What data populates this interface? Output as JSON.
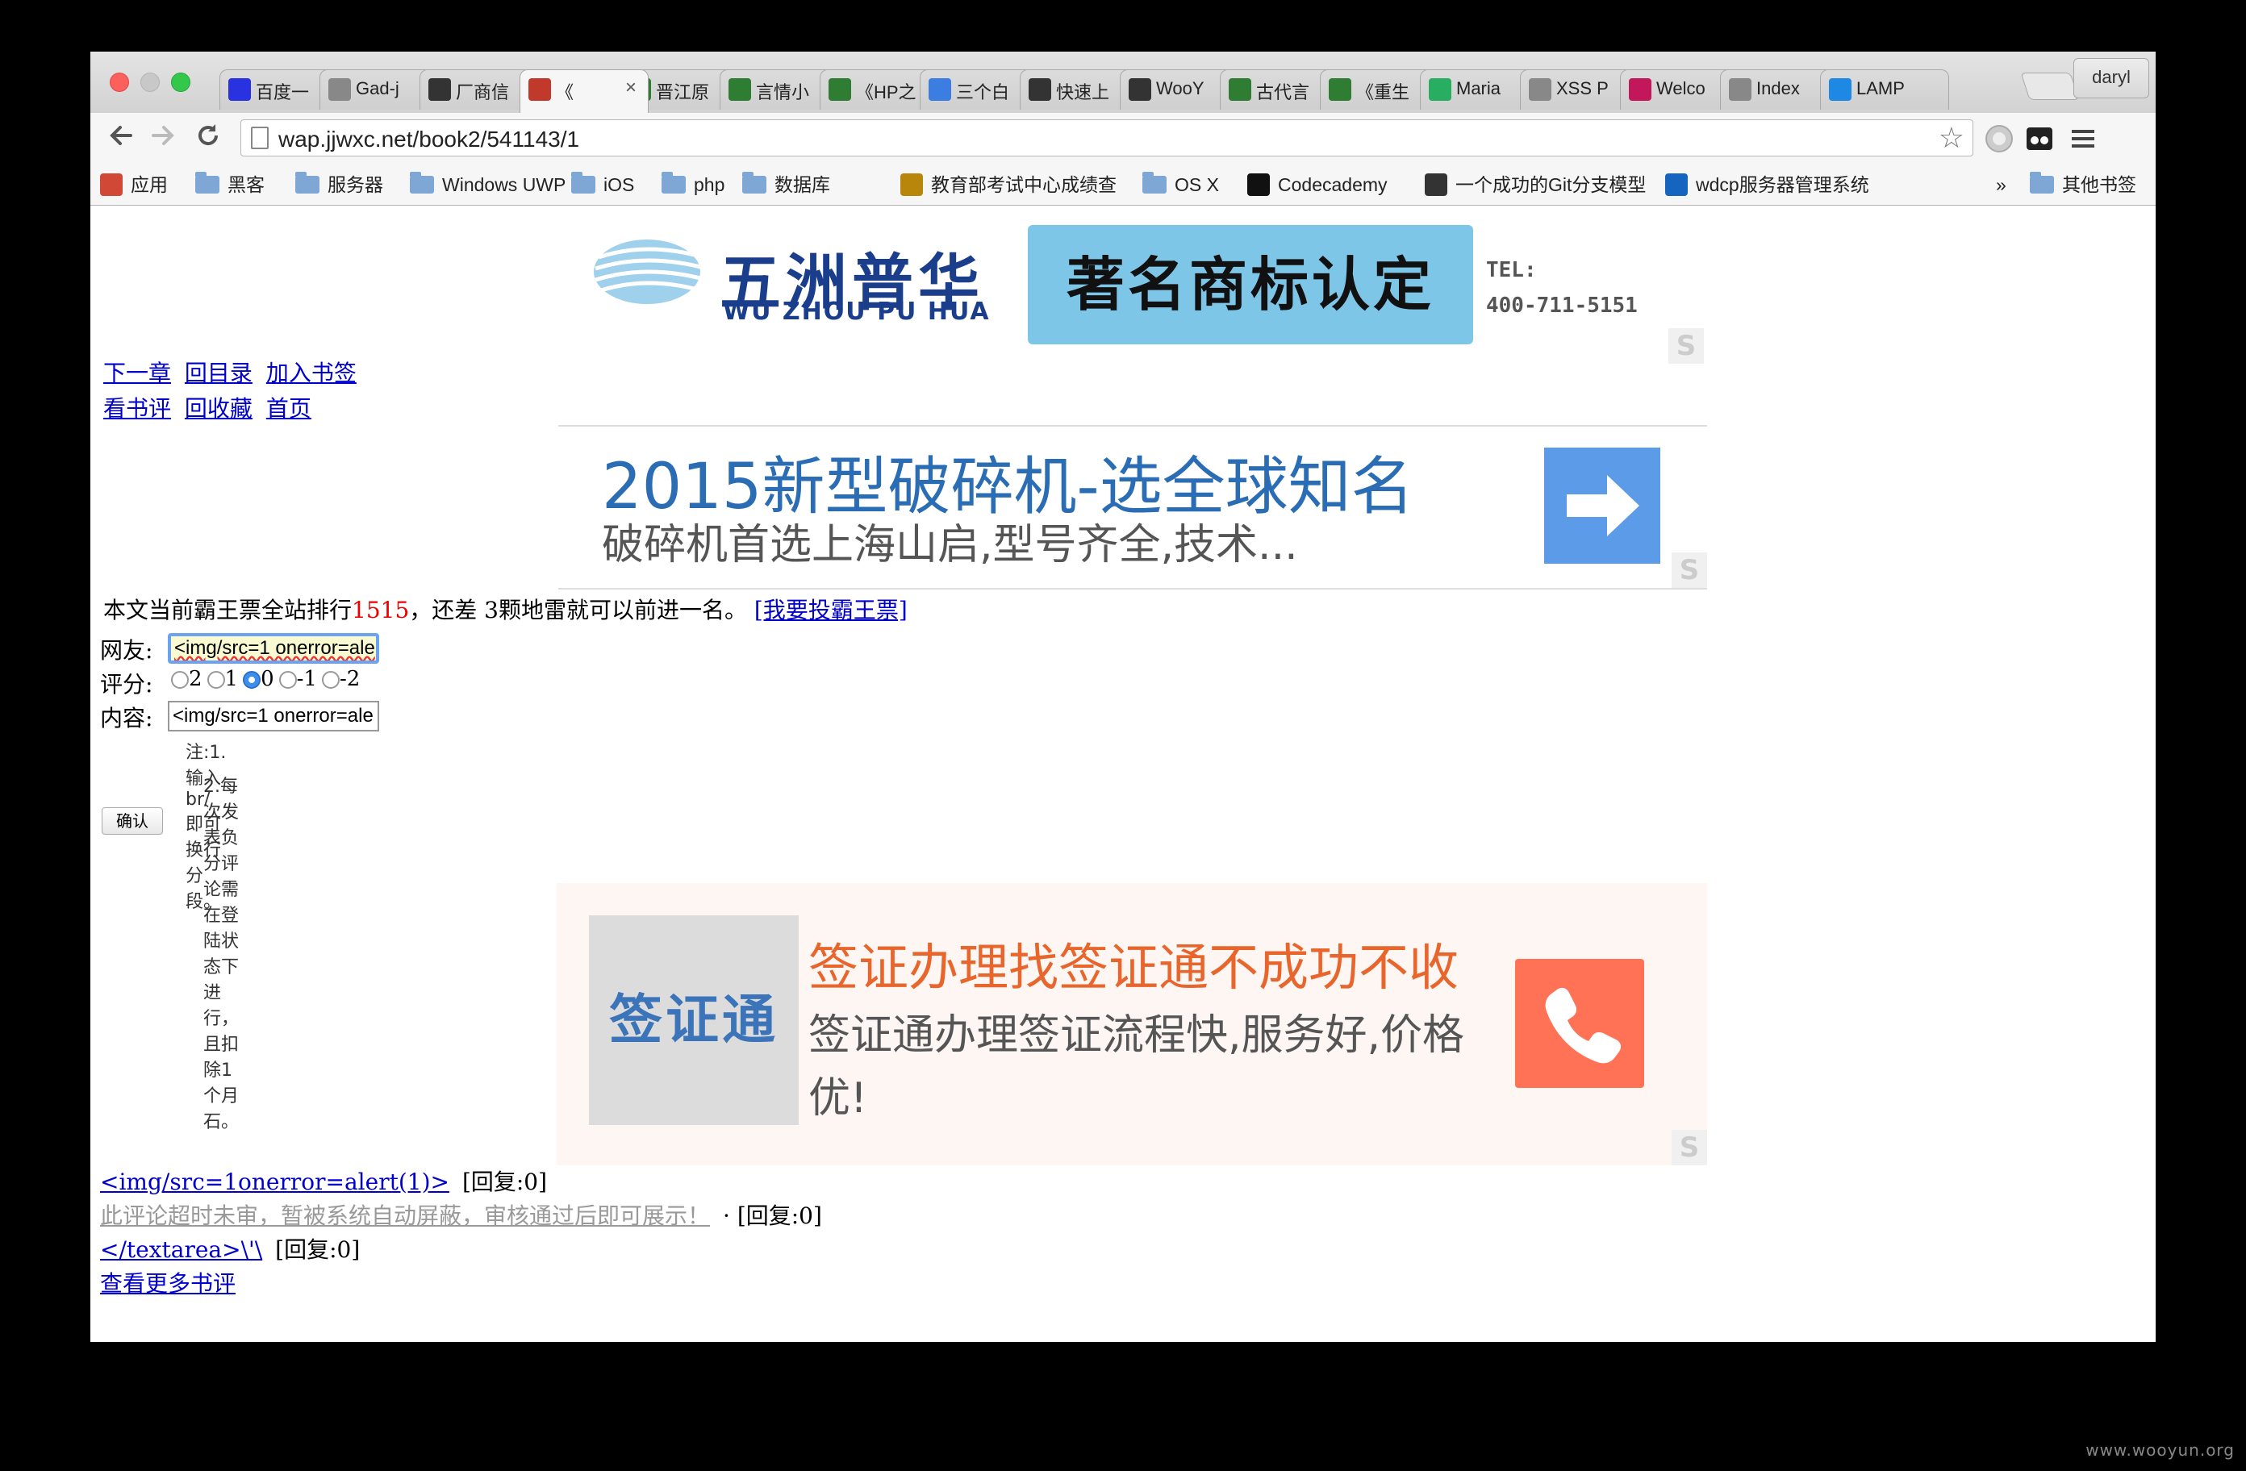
{
  "browser": {
    "profile_name": "daryl",
    "url": "wap.jjwxc.net/book2/541143/1",
    "tabs": [
      {
        "label": "百度一",
        "icon": "paw-icon",
        "color": "#2932e1"
      },
      {
        "label": "Gad-j",
        "icon": "page-icon",
        "color": "#888888"
      },
      {
        "label": "厂商信",
        "icon": "wooyun-icon",
        "color": "#333333"
      },
      {
        "label": "《",
        "icon": "jjwxc-icon",
        "color": "#c0392b"
      },
      {
        "label": "晋江原",
        "icon": "tree-icon",
        "color": "#2e7d32"
      },
      {
        "label": "言情小",
        "icon": "tree-icon",
        "color": "#2e7d32"
      },
      {
        "label": "《HP之",
        "icon": "tree-icon",
        "color": "#2e7d32"
      },
      {
        "label": "三个白",
        "icon": "wave-icon",
        "color": "#3b7de0"
      },
      {
        "label": "快速上",
        "icon": "book-icon",
        "color": "#333333"
      },
      {
        "label": "WooY",
        "icon": "wooyun-icon",
        "color": "#333333"
      },
      {
        "label": "古代言",
        "icon": "tree-icon",
        "color": "#2e7d32"
      },
      {
        "label": "《重生",
        "icon": "tree-icon",
        "color": "#2e7d32"
      },
      {
        "label": "Maria",
        "icon": "mariadb-icon",
        "color": "#27ae60"
      },
      {
        "label": "XSS P",
        "icon": "page-icon",
        "color": "#888888"
      },
      {
        "label": "Welco",
        "icon": "pen-icon",
        "color": "#c2185b"
      },
      {
        "label": "Index",
        "icon": "page-icon",
        "color": "#888888"
      },
      {
        "label": "LAMP",
        "icon": "lamp-icon",
        "color": "#1e88e5"
      }
    ],
    "bookmarks": [
      {
        "label": "应用",
        "icon": "apps-icon"
      },
      {
        "label": "黑客",
        "icon": "folder-icon"
      },
      {
        "label": "服务器",
        "icon": "folder-icon"
      },
      {
        "label": "Windows UWP",
        "icon": "folder-icon"
      },
      {
        "label": "iOS",
        "icon": "folder-icon"
      },
      {
        "label": "php",
        "icon": "folder-icon"
      },
      {
        "label": "数据库",
        "icon": "folder-icon"
      },
      {
        "label": "教育部考试中心成绩查",
        "icon": "neea-icon"
      },
      {
        "label": "OS X",
        "icon": "folder-icon"
      },
      {
        "label": "Codecademy",
        "icon": "codecademy-icon"
      },
      {
        "label": "一个成功的Git分支模型",
        "icon": "github-icon"
      },
      {
        "label": "wdcp服务器管理系统",
        "icon": "wdcp-icon"
      },
      {
        "label": "»",
        "icon": "chevron-icon"
      },
      {
        "label": "其他书签",
        "icon": "folder-icon"
      }
    ]
  },
  "ads": {
    "brand": {
      "name_cn": "五洲普华",
      "name_en": "WU ZHOU PU HUA",
      "badge": "著名商标认定",
      "tel_label": "TEL:",
      "tel": "400-711-5151"
    },
    "crusher": {
      "title": "2015新型破碎机-选全球知名",
      "subtitle": "破碎机首选上海山启,型号齐全,技术..."
    },
    "visa": {
      "logo": "签证通",
      "title": "签证办理找签证通不成功不收",
      "subtitle": "签证通办理签证流程快,服务好,价格优!"
    },
    "badge_letter": "S"
  },
  "nav": {
    "next_chapter": "下一章",
    "back_to_toc": "回目录",
    "add_bookmark": "加入书签",
    "view_reviews": "看书评",
    "back_to_favorites": "回收藏",
    "home": "首页"
  },
  "rank": {
    "prefix": "本文当前霸王票全站排行",
    "number": "1515",
    "suffix": "，还差 3颗地雷就可以前进一名。",
    "vote_link": "[我要投霸王票]"
  },
  "form": {
    "user_label": "网友:",
    "user_value": "<img/src=1 onerror=ale",
    "rating_label": "评分:",
    "rating_options": [
      "2",
      "1",
      "0",
      "-1",
      "-2"
    ],
    "rating_selected": "0",
    "content_label": "内容:",
    "content_value": "<img/src=1 onerror=ale",
    "note1": "注:1.输入br/即可换行分段。",
    "note2": "2.每次发表负分评论需在登陆状态下进行，且扣除1个月石。",
    "submit_label": "确认"
  },
  "comments": [
    {
      "text": "<img/src=1onerror=alert(1)>",
      "reply": "[回复:0]",
      "muted": false
    },
    {
      "text": "此评论超时未审，暂被系统自动屏蔽，审核通过后即可展示！",
      "reply": "· [回复:0]",
      "muted": true
    },
    {
      "text": "</textarea>\\'\\",
      "reply": "[回复:0]",
      "muted": false
    }
  ],
  "more_reviews": "查看更多书评",
  "watermark": "www.wooyun.org",
  "colors": {
    "link": "#0000cc",
    "rank_number": "#ee0000",
    "focus_ring": "#6aa3f0",
    "ad_blue": "#2a6db5",
    "ad_orange": "#e8652c",
    "arrow_button": "#5b9be8",
    "phone_button": "#ff7255"
  }
}
